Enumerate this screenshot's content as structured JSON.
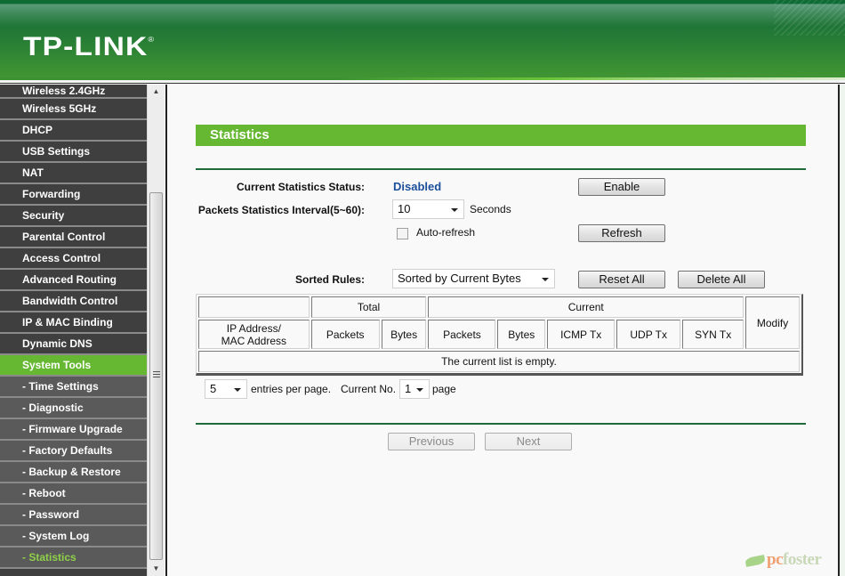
{
  "header": {
    "brand": "TP-LINK",
    "trademark": "®",
    "colors": {
      "header_green": "#1f7536",
      "accent_green": "#66b832",
      "status_blue": "#1b4f9c"
    }
  },
  "sidebar": {
    "items": [
      {
        "label": "Wireless 2.4GHz",
        "type": "main"
      },
      {
        "label": "Wireless 5GHz",
        "type": "main"
      },
      {
        "label": "DHCP",
        "type": "main"
      },
      {
        "label": "USB Settings",
        "type": "main"
      },
      {
        "label": "NAT",
        "type": "main"
      },
      {
        "label": "Forwarding",
        "type": "main"
      },
      {
        "label": "Security",
        "type": "main"
      },
      {
        "label": "Parental Control",
        "type": "main"
      },
      {
        "label": "Access Control",
        "type": "main"
      },
      {
        "label": "Advanced Routing",
        "type": "main"
      },
      {
        "label": "Bandwidth Control",
        "type": "main"
      },
      {
        "label": "IP & MAC Binding",
        "type": "main"
      },
      {
        "label": "Dynamic DNS",
        "type": "main"
      },
      {
        "label": "System Tools",
        "type": "active"
      },
      {
        "label": "- Time Settings",
        "type": "sub"
      },
      {
        "label": "- Diagnostic",
        "type": "sub"
      },
      {
        "label": "- Firmware Upgrade",
        "type": "sub"
      },
      {
        "label": "- Factory Defaults",
        "type": "sub"
      },
      {
        "label": "- Backup & Restore",
        "type": "sub"
      },
      {
        "label": "- Reboot",
        "type": "sub"
      },
      {
        "label": "- Password",
        "type": "sub"
      },
      {
        "label": "- System Log",
        "type": "sub"
      },
      {
        "label": "- Statistics",
        "type": "current"
      }
    ],
    "scroll_up_icon": "▲",
    "scroll_down_icon": "▼"
  },
  "main": {
    "title": "Statistics",
    "status_label": "Current Statistics Status:",
    "status_value": "Disabled",
    "enable_button": "Enable",
    "interval_label": "Packets Statistics Interval(5~60):",
    "interval_value": "10",
    "interval_unit": "Seconds",
    "auto_refresh_label": "Auto-refresh",
    "auto_refresh_checked": false,
    "refresh_button": "Refresh",
    "sorted_rules_label": "Sorted Rules:",
    "sorted_rules_value": "Sorted by Current Bytes",
    "reset_all_button": "Reset All",
    "delete_all_button": "Delete All",
    "table": {
      "group_headers": {
        "total": "Total",
        "current": "Current",
        "modify": "Modify"
      },
      "columns": {
        "ip_mac": "IP Address/\nMAC Address",
        "ip_line1": "IP Address/",
        "ip_line2": "MAC Address",
        "total_packets": "Packets",
        "total_bytes": "Bytes",
        "current_packets": "Packets",
        "current_bytes": "Bytes",
        "icmp_tx": "ICMP Tx",
        "udp_tx": "UDP Tx",
        "syn_tx": "SYN Tx"
      },
      "empty_message": "The current list is empty."
    },
    "pagination": {
      "entries_value": "5",
      "entries_label": "entries per page.",
      "current_label": "Current No.",
      "page_value": "1",
      "page_label": "page",
      "previous_button": "Previous",
      "next_button": "Next"
    }
  },
  "watermark": {
    "part1": "pc",
    "part2": "foster"
  }
}
